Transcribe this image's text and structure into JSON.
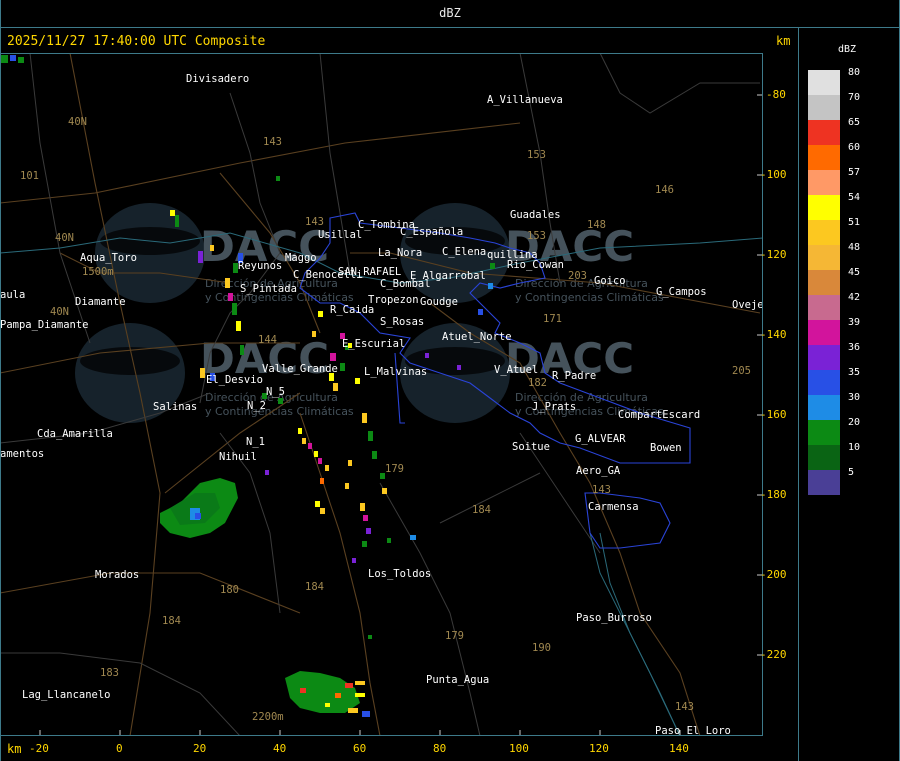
{
  "header": {
    "title": "dBZ"
  },
  "map": {
    "datetime": "2025/11/27 17:40:00 UTC Composite",
    "km_top": "km",
    "km_bottom": "km",
    "y_ticks": [
      "-80",
      "-100",
      "-120",
      "-140",
      "-160",
      "-180",
      "-200",
      "-220"
    ],
    "x_ticks": [
      "-20",
      "0",
      "20",
      "40",
      "60",
      "80",
      "100",
      "120",
      "140"
    ],
    "places": [
      "Divisadero",
      "A_Villanueva",
      "Guadales",
      "Goico",
      "G_Campos",
      "Oveje",
      "Usillal",
      "C_Tombina",
      "C_Española",
      "C_Elena",
      "quillina",
      "Aqua_Toro",
      "Pampa_Diamante",
      "Diamante",
      "Reyunos",
      "Maggo",
      "C_Benocelli",
      "SAN_RAFAEL",
      "La_Nora",
      "E_Algarrobal",
      "C_Bombal",
      "Rio_Cowan",
      "S_Pintada",
      "R_Caida",
      "Tropezon",
      "Goudge",
      "S_Rosas",
      "Atuel_Norte",
      "E_Escurial",
      "Valle_Grande",
      "L_Malvinas",
      "V_Atuel",
      "R_Padre",
      "El_Desvio",
      "N_5",
      "N_2",
      "Salinas",
      "J_Prats",
      "CompartEscard",
      "G_ALVEAR",
      "Bowen",
      "N_1",
      "Cda_Amarilla",
      "Nihuil",
      "Soitue",
      "Aero_GA",
      "Carmensa",
      "Morados",
      "Los_Toldos",
      "Paso_Burroso",
      "Punta_Agua",
      "Lag_Llancanelo",
      "Paso_El_Loro",
      "amentos",
      "aula"
    ],
    "route_numbers": [
      "40N",
      "101",
      "40N",
      "40N",
      "143",
      "153",
      "146",
      "148",
      "153",
      "203",
      "171",
      "144",
      "143",
      "184",
      "179",
      "180",
      "184",
      "184",
      "183",
      "179",
      "190",
      "143",
      "143",
      "182",
      "205",
      "1500m",
      "2200m"
    ],
    "watermark": {
      "brand": "DACC",
      "line1": "Dirección de Agricultura",
      "line2": "y Contingencias Climáticas"
    }
  },
  "legend": {
    "title": "dBZ",
    "items": [
      {
        "label": "80",
        "color": "#e0e0e0"
      },
      {
        "label": "70",
        "color": "#c4c4c4"
      },
      {
        "label": "65",
        "color": "#ee3322"
      },
      {
        "label": "60",
        "color": "#ff6a00"
      },
      {
        "label": "57",
        "color": "#ff9966"
      },
      {
        "label": "54",
        "color": "#ffff00"
      },
      {
        "label": "51",
        "color": "#fcc820"
      },
      {
        "label": "48",
        "color": "#f5b735"
      },
      {
        "label": "45",
        "color": "#d9883a"
      },
      {
        "label": "42",
        "color": "#c86a8f"
      },
      {
        "label": "39",
        "color": "#d2149c"
      },
      {
        "label": "36",
        "color": "#7a22d6"
      },
      {
        "label": "35",
        "color": "#2850e6"
      },
      {
        "label": "30",
        "color": "#1e8ce6"
      },
      {
        "label": "20",
        "color": "#0c8a14"
      },
      {
        "label": "10",
        "color": "#0a6414"
      },
      {
        "label": "5",
        "color": "#4a3f96"
      }
    ]
  }
}
